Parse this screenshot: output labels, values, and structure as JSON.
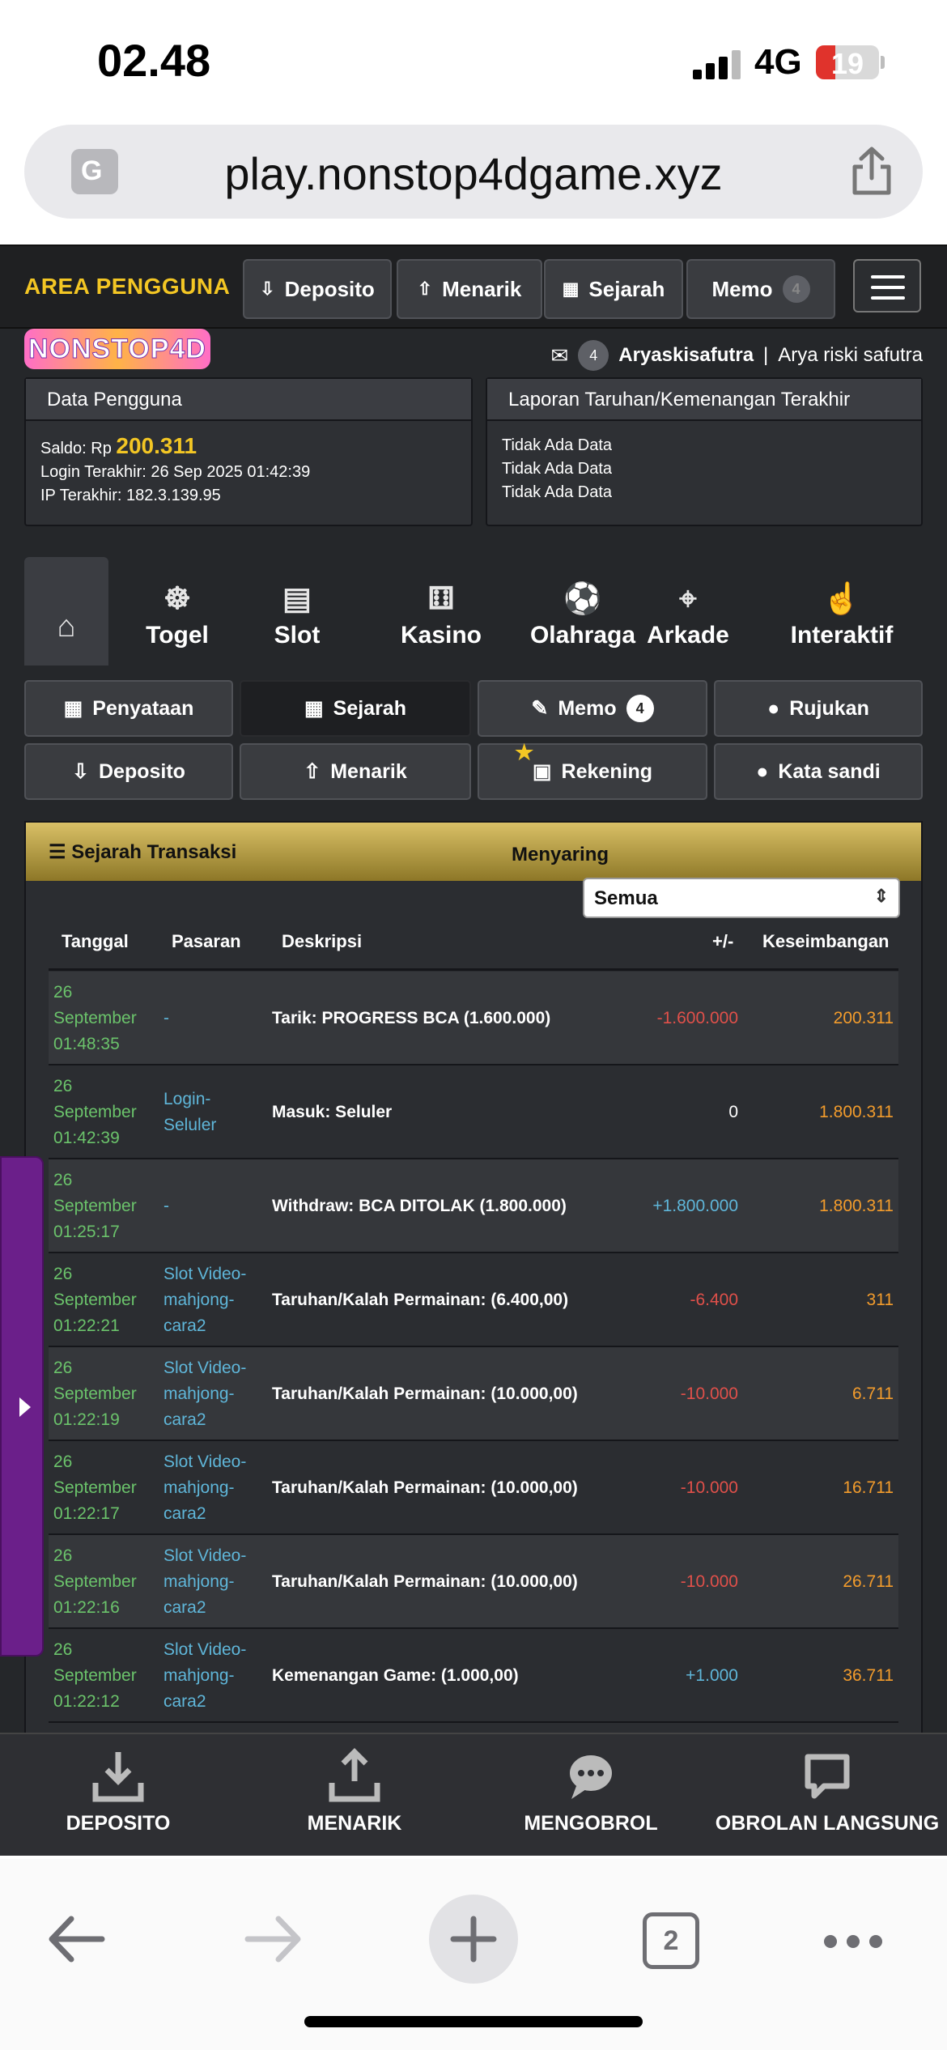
{
  "status": {
    "time": "02.48",
    "network": "4G",
    "battery": "19"
  },
  "browser": {
    "url": "play.nonstop4dgame.xyz",
    "tab_count": "2"
  },
  "topbar": {
    "title": "AREA PENGGUNA",
    "buttons": [
      "Deposito",
      "Menarik",
      "Sejarah",
      "Memo"
    ],
    "memo_badge": "4"
  },
  "logo": "NONSTOP4D",
  "user": {
    "msg_count": "4",
    "username": "Aryaskisafutra",
    "separator": "|",
    "fullname": "Arya riski safutra"
  },
  "data_panel": {
    "title": "Data Pengguna",
    "saldo_label": "Saldo: Rp",
    "saldo_value": "200.311",
    "login_line": "Login Terakhir: 26 Sep 2025 01:42:39",
    "ip_line": "IP Terakhir: 182.3.139.95"
  },
  "report_panel": {
    "title": "Laporan Taruhan/Kemenangan Terakhir",
    "lines": [
      "Tidak Ada Data",
      "Tidak Ada Data",
      "Tidak Ada Data"
    ]
  },
  "categories": [
    "Togel",
    "Slot",
    "Kasino",
    "Olahraga",
    "Arkade",
    "Interaktif"
  ],
  "submenu": {
    "row1": [
      "Penyataan",
      "Sejarah",
      "Memo",
      "Rujukan"
    ],
    "memo_badge": "4",
    "row2": [
      "Deposito",
      "Menarik",
      "Rekening",
      "Kata sandi"
    ]
  },
  "transactions": {
    "title": "Sejarah Transaksi",
    "filter_label": "Menyaring",
    "filter_value": "Semua",
    "headers": [
      "Tanggal",
      "Pasaran",
      "Deskripsi",
      "+/-",
      "Keseimbangan"
    ],
    "rows": [
      {
        "date": [
          "26",
          "September",
          "01:48:35"
        ],
        "market": [
          "-"
        ],
        "desc": "Tarik: PROGRESS BCA (1.600.000)",
        "amount": "-1.600.000",
        "balance": "200.311"
      },
      {
        "date": [
          "26",
          "September",
          "01:42:39"
        ],
        "market": [
          "Login-",
          "Seluler"
        ],
        "desc": "Masuk: Seluler",
        "amount": "0",
        "balance": "1.800.311"
      },
      {
        "date": [
          "26",
          "September",
          "01:25:17"
        ],
        "market": [
          "-"
        ],
        "desc": "Withdraw: BCA DITOLAK (1.800.000)",
        "amount": "+1.800.000",
        "balance": "1.800.311"
      },
      {
        "date": [
          "26",
          "September",
          "01:22:21"
        ],
        "market": [
          "Slot Video-",
          "mahjong-",
          "cara2"
        ],
        "desc": "Taruhan/Kalah Permainan: (6.400,00)",
        "amount": "-6.400",
        "balance": "311"
      },
      {
        "date": [
          "26",
          "September",
          "01:22:19"
        ],
        "market": [
          "Slot Video-",
          "mahjong-",
          "cara2"
        ],
        "desc": "Taruhan/Kalah Permainan: (10.000,00)",
        "amount": "-10.000",
        "balance": "6.711"
      },
      {
        "date": [
          "26",
          "September",
          "01:22:17"
        ],
        "market": [
          "Slot Video-",
          "mahjong-",
          "cara2"
        ],
        "desc": "Taruhan/Kalah Permainan: (10.000,00)",
        "amount": "-10.000",
        "balance": "16.711"
      },
      {
        "date": [
          "26",
          "September",
          "01:22:16"
        ],
        "market": [
          "Slot Video-",
          "mahjong-",
          "cara2"
        ],
        "desc": "Taruhan/Kalah Permainan: (10.000,00)",
        "amount": "-10.000",
        "balance": "26.711"
      },
      {
        "date": [
          "26",
          "September",
          "01:22:12"
        ],
        "market": [
          "Slot Video-",
          "mahjong-",
          "cara2"
        ],
        "desc": "Kemenangan Game: (1.000,00)",
        "amount": "+1.000",
        "balance": "36.711"
      }
    ]
  },
  "bottom_bar": [
    "DEPOSITO",
    "MENARIK",
    "MENGOBROL",
    "OBROLAN LANGSUNG"
  ],
  "colors": {
    "accent": "#f3c624",
    "negative": "#e0504a",
    "positive": "#5fb6d9",
    "date": "#6bc36b",
    "balance": "#f39c2c"
  }
}
